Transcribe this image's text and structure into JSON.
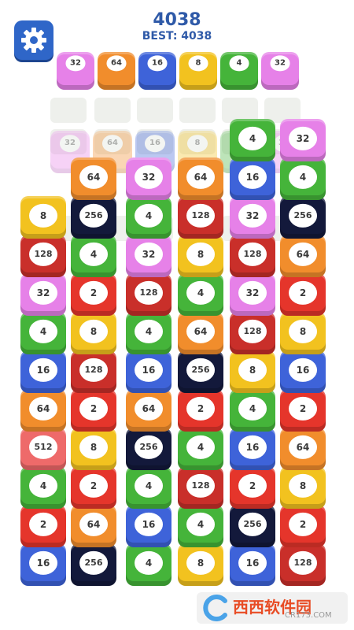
{
  "header": {
    "score": "4038",
    "best_label": "BEST:",
    "best_value": "4038"
  },
  "settings": {
    "icon": "gear-icon",
    "color": "#2f66c8"
  },
  "palette": {
    "2": "#e5352b",
    "4": "#45b43a",
    "8": "#f2c21f",
    "16": "#3e63d9",
    "32": "#e681e8",
    "64": "#f18d2c",
    "128": "#c92f2a",
    "256": "#13193b",
    "512": "#ee6a6a"
  },
  "queue": [
    "32",
    "64",
    "16",
    "8",
    "4",
    "32"
  ],
  "preview_row": [
    "32",
    "64",
    "16",
    "8",
    "4",
    "32"
  ],
  "columns": [
    [
      "16",
      "2",
      "4",
      "512",
      "64",
      "16",
      "4",
      "32",
      "128",
      "8"
    ],
    [
      "256",
      "64",
      "2",
      "8",
      "2",
      "128",
      "8",
      "2",
      "4",
      "256",
      "64"
    ],
    [
      "4",
      "16",
      "4",
      "256",
      "64",
      "16",
      "4",
      "128",
      "32",
      "4",
      "32"
    ],
    [
      "8",
      "4",
      "128",
      "4",
      "2",
      "256",
      "64",
      "4",
      "8",
      "128",
      "64"
    ],
    [
      "16",
      "256",
      "2",
      "16",
      "4",
      "8",
      "128",
      "32",
      "128",
      "32",
      "16",
      "4"
    ],
    [
      "128",
      "2",
      "8",
      "64",
      "2",
      "16",
      "8",
      "2",
      "64",
      "256",
      "4",
      "32"
    ]
  ],
  "watermark": {
    "title": "西西软件园",
    "subtitle": "CR173.COM"
  }
}
